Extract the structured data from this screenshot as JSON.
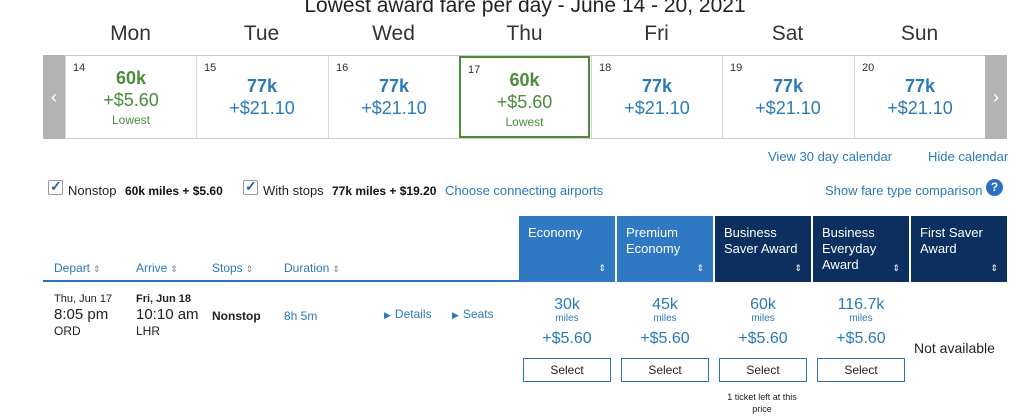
{
  "title": "Lowest award fare per day - June 14 - 20, 2021",
  "days": [
    "Mon",
    "Tue",
    "Wed",
    "Thu",
    "Fri",
    "Sat",
    "Sun"
  ],
  "calendar": [
    {
      "date": "14",
      "miles": "60k",
      "tax": "+$5.60",
      "note": "Lowest"
    },
    {
      "date": "15",
      "miles": "77k",
      "tax": "+$21.10",
      "note": ""
    },
    {
      "date": "16",
      "miles": "77k",
      "tax": "+$21.10",
      "note": ""
    },
    {
      "date": "17",
      "miles": "60k",
      "tax": "+$5.60",
      "note": "Lowest"
    },
    {
      "date": "18",
      "miles": "77k",
      "tax": "+$21.10",
      "note": ""
    },
    {
      "date": "19",
      "miles": "77k",
      "tax": "+$21.10",
      "note": ""
    },
    {
      "date": "20",
      "miles": "77k",
      "tax": "+$21.10",
      "note": ""
    }
  ],
  "icons": {
    "prev": "chevron-left-icon",
    "next": "chevron-right-icon",
    "help": "question-circle-icon",
    "sort": "sort-arrows-icon",
    "expand": "triangle-right-icon"
  },
  "links": {
    "view30": "View 30 day calendar",
    "hide_calendar": "Hide calendar",
    "connecting": "Choose connecting airports",
    "show_fare": "Show fare type comparison"
  },
  "filters": {
    "nonstop_label": "Nonstop",
    "nonstop_value": "60k miles + $5.60",
    "withstops_label": "With stops",
    "withstops_value": "77k miles + $19.20"
  },
  "columns": {
    "depart": "Depart",
    "arrive": "Arrive",
    "stops": "Stops",
    "duration": "Duration"
  },
  "fare_types": [
    {
      "line1": "Economy",
      "line2": "",
      "line3": ""
    },
    {
      "line1": "Premium",
      "line2": "Economy",
      "line3": ""
    },
    {
      "line1": "Business",
      "line2": "Saver Award",
      "line3": ""
    },
    {
      "line1": "Business",
      "line2": "Everyday",
      "line3": "Award"
    },
    {
      "line1": "First Saver",
      "line2": "Award",
      "line3": ""
    }
  ],
  "flight": {
    "depart_date": "Thu, Jun 17",
    "depart_time": "8:05 pm",
    "depart_airport": "ORD",
    "arrive_date": "Fri, Jun 18",
    "arrive_time": "10:10 am",
    "arrive_airport": "LHR",
    "stops": "Nonstop",
    "duration": "8h 5m",
    "details": "Details",
    "seats": "Seats"
  },
  "prices": [
    {
      "miles": "30k",
      "unit": "miles",
      "tax": "+$5.60",
      "button": "Select"
    },
    {
      "miles": "45k",
      "unit": "miles",
      "tax": "+$5.60",
      "button": "Select"
    },
    {
      "miles": "60k",
      "unit": "miles",
      "tax": "+$5.60",
      "button": "Select"
    },
    {
      "miles": "116.7k",
      "unit": "miles",
      "tax": "+$5.60",
      "button": "Select"
    }
  ],
  "ticket_note": "1 ticket left at this price",
  "not_available": "Not available"
}
